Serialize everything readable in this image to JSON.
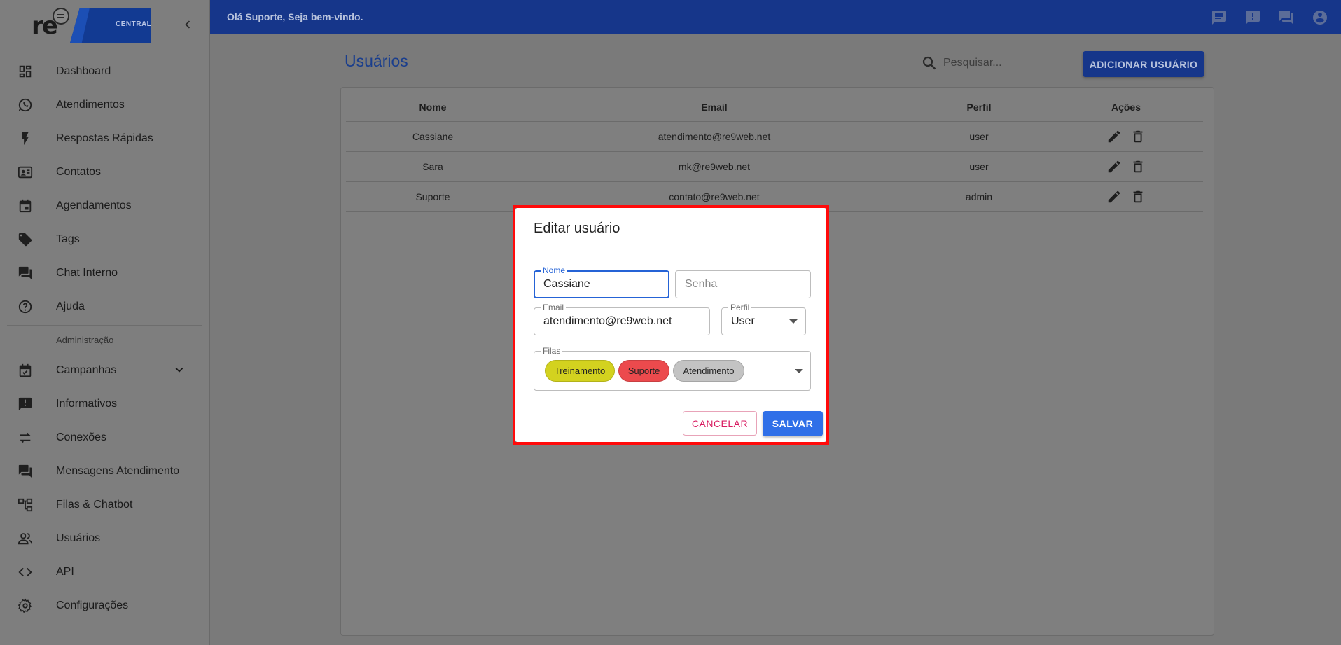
{
  "brand": {
    "logo_text": "re",
    "badge_text": "CENTRAL"
  },
  "sidebar": {
    "items": [
      {
        "label": "Dashboard",
        "icon": "dashboard-icon"
      },
      {
        "label": "Atendimentos",
        "icon": "whatsapp-icon"
      },
      {
        "label": "Respostas Rápidas",
        "icon": "flash-icon"
      },
      {
        "label": "Contatos",
        "icon": "contact-card-icon"
      },
      {
        "label": "Agendamentos",
        "icon": "calendar-icon"
      },
      {
        "label": "Tags",
        "icon": "tag-icon"
      },
      {
        "label": "Chat Interno",
        "icon": "forum-icon"
      },
      {
        "label": "Ajuda",
        "icon": "help-icon"
      }
    ],
    "admin_header": "Administração",
    "admin_items": [
      {
        "label": "Campanhas",
        "icon": "event-check-icon"
      },
      {
        "label": "Informativos",
        "icon": "announcement-icon"
      },
      {
        "label": "Conexões",
        "icon": "sync-arrows-icon"
      },
      {
        "label": "Mensagens Atendimento",
        "icon": "forum-icon"
      },
      {
        "label": "Filas & Chatbot",
        "icon": "account-tree-icon"
      },
      {
        "label": "Usuários",
        "icon": "people-icon"
      },
      {
        "label": "API",
        "icon": "code-icon"
      },
      {
        "label": "Configurações",
        "icon": "gear-icon"
      }
    ]
  },
  "topbar": {
    "greeting": "Olá Suporte, Seja bem-vindo.",
    "icons": [
      "chat-icon",
      "announcement-icon",
      "forum-icon",
      "account-circle-icon"
    ]
  },
  "main": {
    "title": "Usuários",
    "search_placeholder": "Pesquisar...",
    "add_button": "ADICIONAR USUÁRIO",
    "table": {
      "headers": [
        "Nome",
        "Email",
        "Perfil",
        "Ações"
      ],
      "rows": [
        {
          "nome": "Cassiane",
          "email": "atendimento@re9web.net",
          "perfil": "user"
        },
        {
          "nome": "Sara",
          "email": "mk@re9web.net",
          "perfil": "user"
        },
        {
          "nome": "Suporte",
          "email": "contato@re9web.net",
          "perfil": "admin"
        }
      ]
    }
  },
  "modal": {
    "title": "Editar usuário",
    "nome_label": "Nome",
    "nome_value": "Cassiane",
    "senha_placeholder": "Senha",
    "email_label": "Email",
    "email_value": "atendimento@re9web.net",
    "perfil_label": "Perfil",
    "perfil_value": "User",
    "filas_label": "Filas",
    "filas": [
      {
        "label": "Treinamento",
        "color": "#d3d21f"
      },
      {
        "label": "Suporte",
        "color": "#ec4a4d"
      },
      {
        "label": "Atendimento",
        "color": "#c3c3c3"
      }
    ],
    "cancel_label": "CANCELAR",
    "save_label": "SALVAR"
  },
  "colors": {
    "topbar": "#16368a",
    "highlight_border": "#ff0a0a",
    "save_button": "#2f6fe8",
    "cancel_text": "#d81b60"
  }
}
